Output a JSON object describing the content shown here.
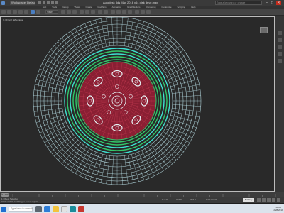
{
  "titlebar": {
    "workspace": "Workspace: Default",
    "title": "Autodesk 3ds Max 2016 x64     disk drive.max",
    "search_placeholder": "Type a keyword or phrase",
    "minimize": "–",
    "maximize": "□",
    "close": "✕"
  },
  "menubar": {
    "items": [
      "Edit",
      "Tools",
      "Group",
      "Views",
      "Create",
      "Modifiers",
      "Animation",
      "Graph Editors",
      "Rendering",
      "Customize",
      "Scripting",
      "Help"
    ]
  },
  "toolbar": {
    "view_select": "View"
  },
  "viewport": {
    "label": "[+] [Front] [Wireframe]",
    "colors": {
      "background": "#292929",
      "tire_wire": "#bfe7ef",
      "rim_green": "#32c86a",
      "rim_cyan": "#3fe0d0",
      "hub_red": "#8a1f33",
      "bolt_white": "#e8f4f6"
    }
  },
  "timeline": {
    "frame_label": "0 / 100"
  },
  "statusbar": {
    "status_text": "1 Object Selected",
    "prompt_text": "Click or click-and-drag to select objects",
    "x_value": "X: 0.0",
    "y_value": "Y: 0.0",
    "z_value": "Z: 0.0",
    "grid_value": "Grid = 10.0",
    "set_key": "Set Key"
  },
  "taskbar": {
    "search_placeholder": "Type here to search",
    "time": "10:24",
    "date": "2/28/2019"
  }
}
